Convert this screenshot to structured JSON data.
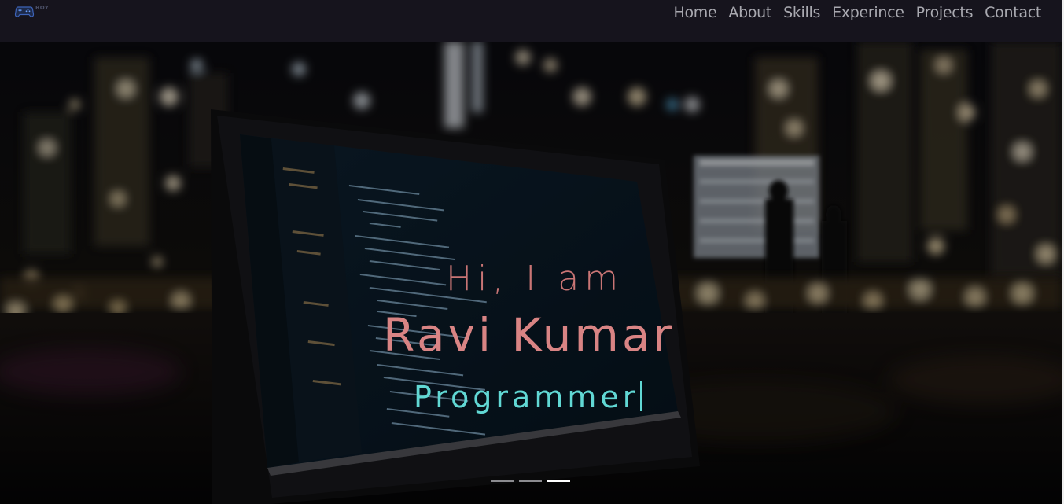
{
  "brand": {
    "logo_icon": "gamepad-icon",
    "logo_text": "ROY"
  },
  "nav": {
    "items": [
      {
        "label": "Home"
      },
      {
        "label": "About"
      },
      {
        "label": "Skills"
      },
      {
        "label": "Experince"
      },
      {
        "label": "Projects"
      },
      {
        "label": "Contact"
      }
    ]
  },
  "hero": {
    "greeting": "Hi, I am",
    "name": "Ravi Kumar",
    "role": "Programmer",
    "background": "night-city-laptop-code-photo",
    "slides": {
      "count": 3,
      "active_index": 2
    }
  },
  "colors": {
    "navbar_bg": "#16141d",
    "nav_text": "#a9a9b0",
    "greeting": "#c97575",
    "name": "#d98484",
    "role": "#61d8d4",
    "indicator": "#8b8b8f",
    "indicator_active": "#ffffff"
  }
}
